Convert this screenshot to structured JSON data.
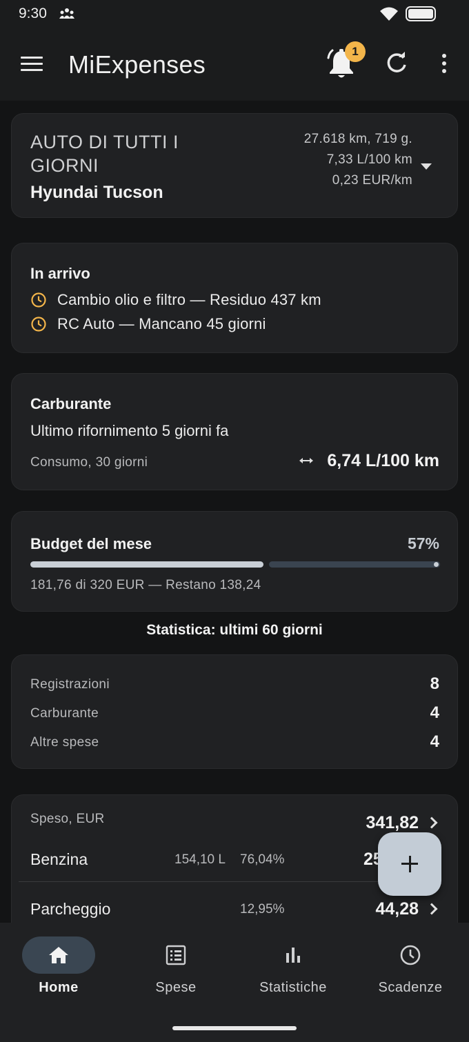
{
  "status": {
    "time": "9:30"
  },
  "app": {
    "title": "MiExpenses",
    "notification_count": "1"
  },
  "vehicle": {
    "type": "AUTO DI TUTTI I GIORNI",
    "name": "Hyundai Tucson",
    "distance": "27.618 km, 719 g.",
    "consumption": "7,33 L/100 km",
    "cost_per_km": "0,23 EUR/km"
  },
  "upcoming": {
    "title": "In arrivo",
    "items": [
      {
        "text": "Cambio olio e filtro — Residuo 437 km"
      },
      {
        "text": "RC Auto — Mancano 45 giorni"
      }
    ]
  },
  "fuel": {
    "title": "Carburante",
    "last_refuel": "Ultimo rifornimento 5 giorni fa",
    "consumption_label": "Consumo, 30 giorni",
    "consumption_value": "6,74 L/100 km"
  },
  "budget": {
    "title": "Budget del mese",
    "percent_label": "57%",
    "progress": 0.57,
    "summary": "181,76 di 320 EUR — Restano 138,24"
  },
  "statistics": {
    "title": "Statistica: ultimi 60 giorni",
    "counts": [
      {
        "label": "Registrazioni",
        "value": "8"
      },
      {
        "label": "Carburante",
        "value": "4"
      },
      {
        "label": "Altre spese",
        "value": "4"
      }
    ],
    "spent": {
      "label": "Speso, EUR",
      "total": "341,82",
      "rows": [
        {
          "name": "Benzina",
          "liters": "154,10 L",
          "percent": "76,04%",
          "amount": "25"
        },
        {
          "name": "Parcheggio",
          "liters": "",
          "percent": "12,95%",
          "amount": "44,28"
        }
      ]
    }
  },
  "nav": {
    "items": [
      {
        "label": "Home",
        "icon": "home-icon",
        "active": true
      },
      {
        "label": "Spese",
        "icon": "list-icon",
        "active": false
      },
      {
        "label": "Statistiche",
        "icon": "bar-chart-icon",
        "active": false
      },
      {
        "label": "Scadenze",
        "icon": "clock-icon",
        "active": false
      }
    ]
  },
  "colors": {
    "accent": "#c3ccd6",
    "badge": "#f3b54a",
    "clock": "#f3b54a",
    "background": "#131415",
    "card": "#202123"
  }
}
